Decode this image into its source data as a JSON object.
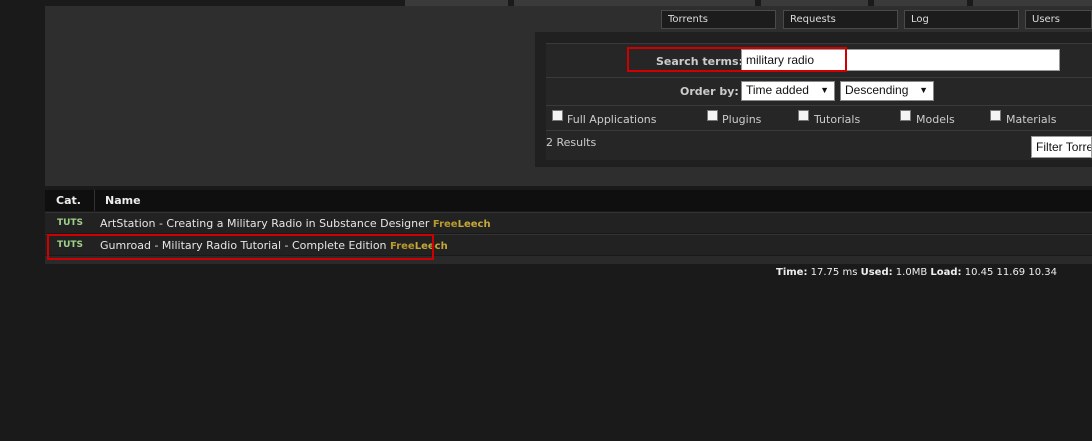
{
  "nav": {
    "items": [
      "Torrents",
      "Requests",
      "Log",
      "Users"
    ]
  },
  "search": {
    "label": "Search terms:",
    "value": "military radio",
    "order_label": "Order by:",
    "order_field": "Time added",
    "order_dir": "Descending",
    "categories": [
      "Full Applications",
      "Plugins",
      "Tutorials",
      "Models",
      "Materials"
    ],
    "results": "2 Results",
    "filter_button": "Filter Torrents"
  },
  "table": {
    "headers": [
      "Cat.",
      "Name"
    ],
    "rows": [
      {
        "cat": "TUTS",
        "name": "ArtStation - Creating a Military Radio in Substance Designer",
        "tag_a": "Free",
        "tag_b": "Leech"
      },
      {
        "cat": "TUTS",
        "name": "Gumroad - Military Radio Tutorial - Complete Edition",
        "tag_a": "Free",
        "tag_b": "Leech"
      }
    ]
  },
  "footer": {
    "time_label": "Time:",
    "time_value": "17.75 ms",
    "used_label": "Used:",
    "used_value": "1.0MB",
    "load_label": "Load:",
    "load_value": "10.45 11.69 10.34"
  },
  "colors": {
    "highlight": "#d10000",
    "category": "#9fd08a",
    "freeleech": "#b89a2e"
  }
}
